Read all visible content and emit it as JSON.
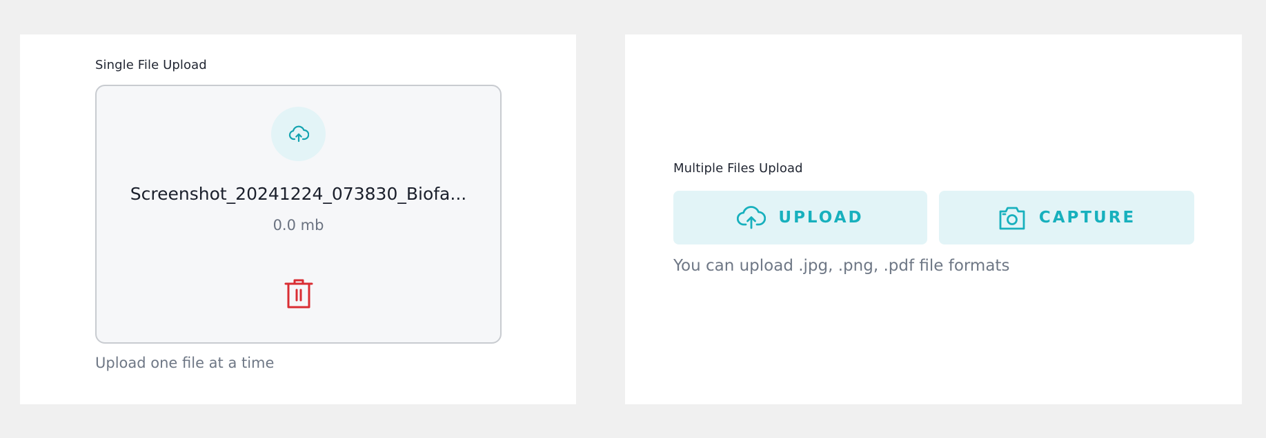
{
  "single_upload": {
    "label": "Single File Upload",
    "file_name": "Screenshot_20241224_073830_Biofa...",
    "file_size": "0.0 mb",
    "helper_text": "Upload one file at a time",
    "upload_icon": "cloud-upload-icon",
    "delete_icon": "trash-icon"
  },
  "multiple_upload": {
    "label": "Multiple Files Upload",
    "upload_button": "UPLOAD",
    "capture_button": "CAPTURE",
    "helper_text": "You can upload .jpg, .png, .pdf file formats",
    "upload_icon": "cloud-upload-icon",
    "capture_icon": "camera-icon"
  },
  "colors": {
    "accent": "#17b0bd",
    "accent_bg": "#e2f4f7",
    "danger": "#d92d33"
  }
}
